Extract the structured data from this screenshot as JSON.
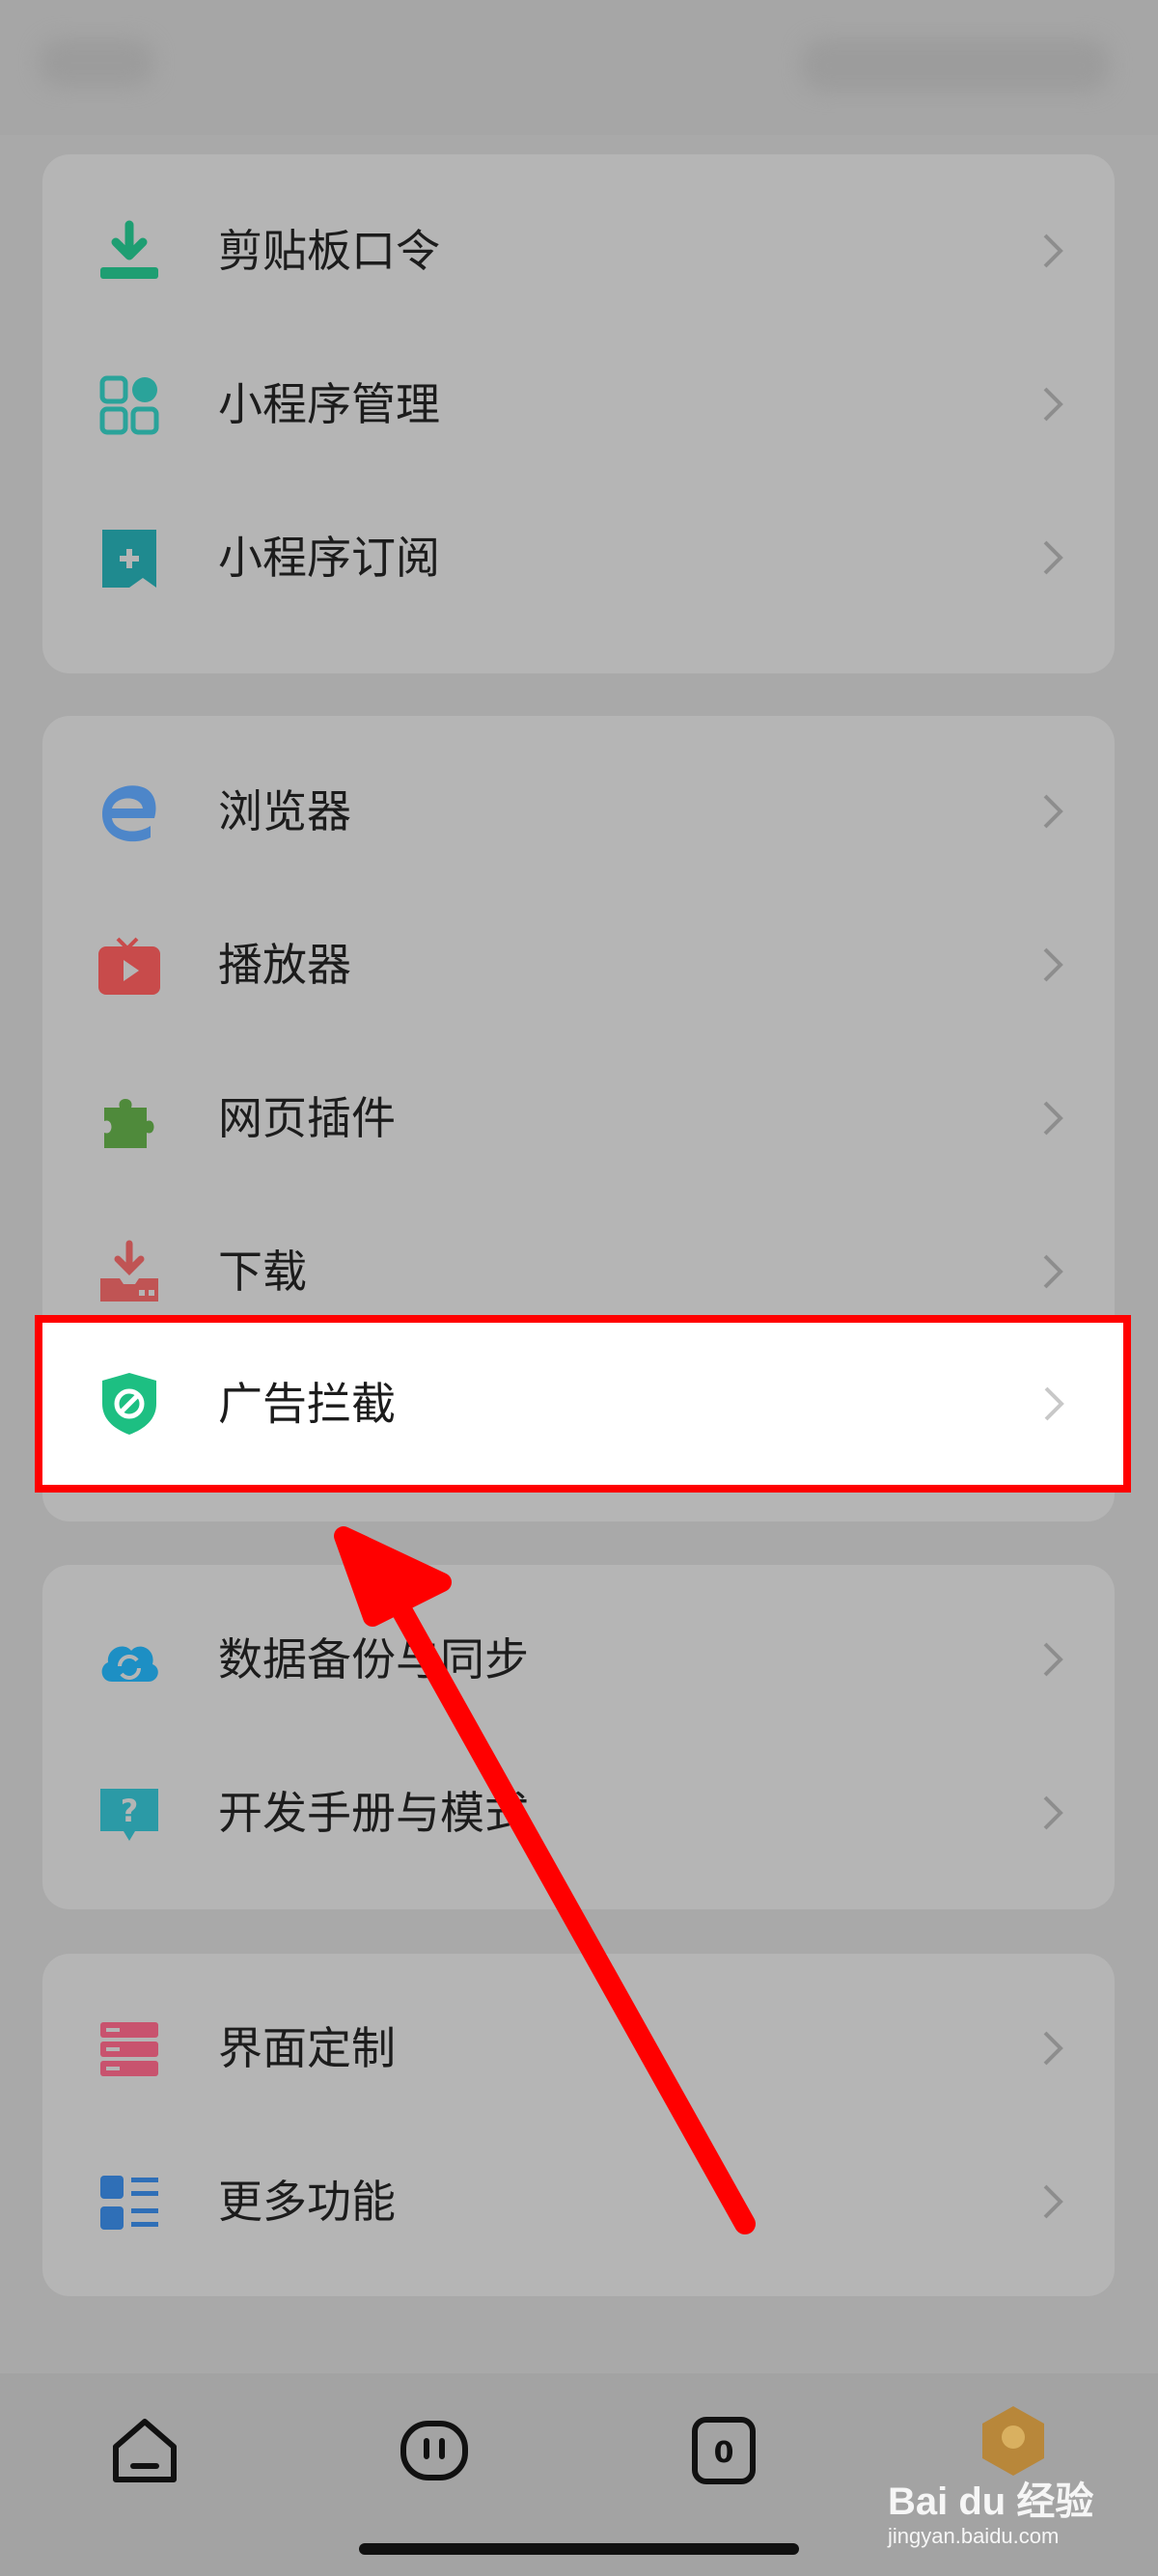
{
  "menu": {
    "group1": [
      {
        "label": "剪贴板口令",
        "icon": "clipboard-download-icon",
        "color": "#1e9e72"
      },
      {
        "label": "小程序管理",
        "icon": "miniprogram-grid-icon",
        "color": "#2aa39a"
      },
      {
        "label": "小程序订阅",
        "icon": "bookmark-plus-icon",
        "color": "#1f8a8f"
      }
    ],
    "group2": [
      {
        "label": "浏览器",
        "icon": "browser-e-icon",
        "color": "#4d86c9"
      },
      {
        "label": "播放器",
        "icon": "tv-play-icon",
        "color": "#c84b4b"
      },
      {
        "label": "网页插件",
        "icon": "puzzle-icon",
        "color": "#4f8a3b"
      },
      {
        "label": "下载",
        "icon": "download-tray-icon",
        "color": "#c05454"
      },
      {
        "label": "广告拦截",
        "icon": "shield-block-icon",
        "color": "#1dbf82"
      }
    ],
    "group3": [
      {
        "label": "数据备份与同步",
        "icon": "cloud-sync-icon",
        "color": "#1d8fc4"
      },
      {
        "label": "开发手册与模式",
        "icon": "help-bubble-icon",
        "color": "#2b9aa6"
      }
    ],
    "group4": [
      {
        "label": "界面定制",
        "icon": "layout-stack-icon",
        "color": "#c8536e"
      },
      {
        "label": "更多功能",
        "icon": "list-more-icon",
        "color": "#2f6fb7"
      }
    ]
  },
  "highlight_color": "#ff0000",
  "bottom_nav": [
    {
      "icon": "home-icon"
    },
    {
      "icon": "face-icon"
    },
    {
      "icon": "tabs-count-icon",
      "count": "0"
    },
    {
      "icon": "profile-badge-icon"
    }
  ],
  "watermark": {
    "main": "Bai du 经验",
    "sub": "jingyan.baidu.com"
  }
}
